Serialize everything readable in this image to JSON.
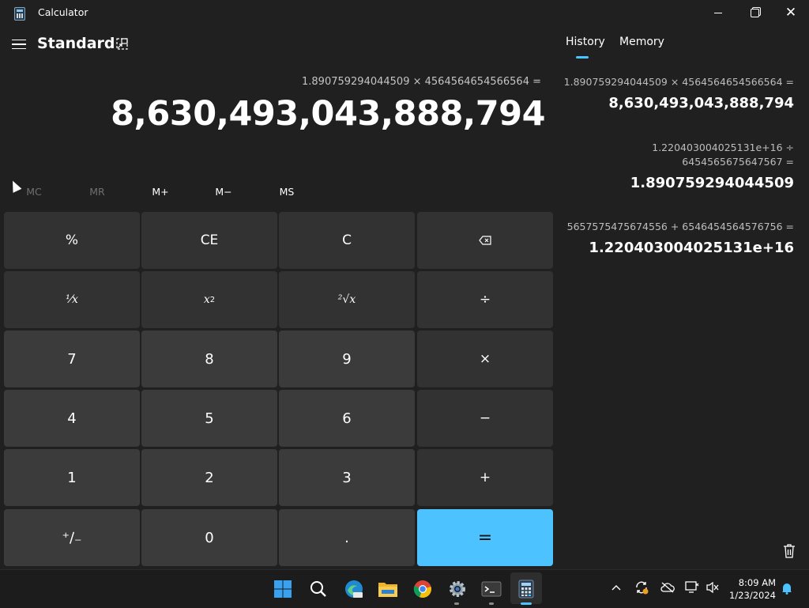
{
  "window": {
    "title": "Calculator"
  },
  "header": {
    "mode": "Standard"
  },
  "display": {
    "expression": "1.890759294044509 × 4564564654566564 =",
    "result": "8,630,493,043,888,794"
  },
  "memory_buttons": [
    "MC",
    "MR",
    "M+",
    "M−",
    "MS"
  ],
  "keys": {
    "percent": "%",
    "ce": "CE",
    "c": "C",
    "backspace": "⌫",
    "reciprocal": "⅟x",
    "square": "x",
    "square_sup": "2",
    "sqrt": "²√x",
    "divide": "÷",
    "seven": "7",
    "eight": "8",
    "nine": "9",
    "multiply": "×",
    "four": "4",
    "five": "5",
    "six": "6",
    "minus": "−",
    "one": "1",
    "two": "2",
    "three": "3",
    "plus": "+",
    "negate": "⁺∕₋",
    "zero": "0",
    "decimal": ".",
    "equals": "="
  },
  "pane": {
    "tabs": [
      "History",
      "Memory"
    ],
    "active_tab": "History",
    "history": [
      {
        "expr_line1": "1.890759294044509   ×   4564564654566564 =",
        "result": "8,630,493,043,888,794"
      },
      {
        "expr_line1": "1.220403004025131e+16   ÷",
        "expr_line2": "6454565675647567 =",
        "result": "1.890759294044509"
      },
      {
        "expr_line1": "5657575475674556   +   6546454564576756 =",
        "result": "1.220403004025131e+16"
      }
    ]
  },
  "taskbar": {
    "icons": [
      "windows-start-icon",
      "search-icon",
      "edge-browser-icon",
      "file-explorer-icon",
      "chrome-icon",
      "settings-icon",
      "terminal-icon",
      "calculator-icon"
    ],
    "time": "8:09 AM",
    "date": "1/23/2024"
  },
  "colors": {
    "accent": "#4cc2ff",
    "background": "#202020",
    "key_num": "#3b3b3b",
    "key_op": "#323232"
  }
}
